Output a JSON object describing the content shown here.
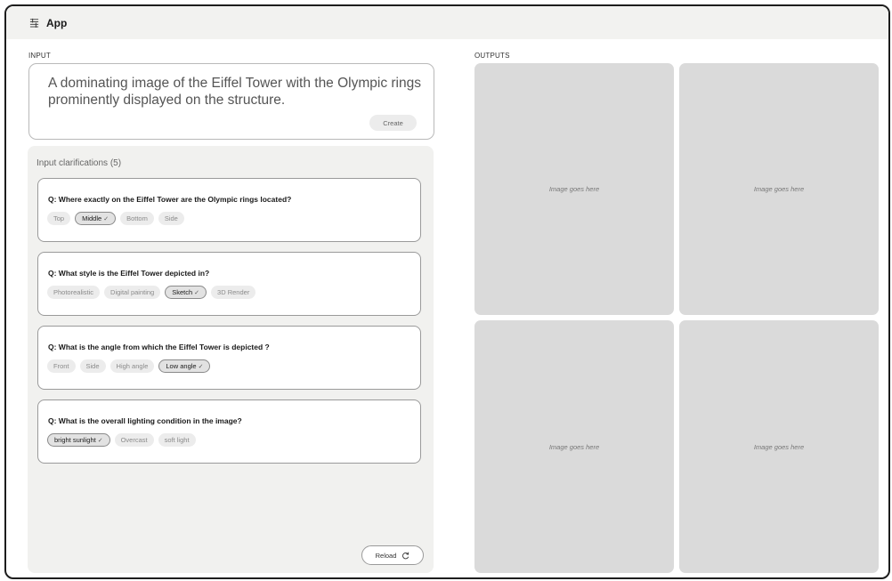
{
  "app": {
    "title": "App",
    "icon": "app-logo-icon"
  },
  "input": {
    "label": "INPUT",
    "prompt": "A dominating image of the Eiffel Tower with the Olympic rings prominently displayed on the structure.",
    "create_label": "Create"
  },
  "clarifications": {
    "title": "Input clarifications (5)",
    "questions": [
      {
        "question": "Q: Where exactly on the Eiffel Tower are the Olympic rings located?",
        "options": [
          {
            "label": "Top",
            "selected": false
          },
          {
            "label": "Middle",
            "selected": true
          },
          {
            "label": "Bottom",
            "selected": false
          },
          {
            "label": "Side",
            "selected": false
          }
        ]
      },
      {
        "question": "Q: What style is the Eiffel Tower depicted in?",
        "options": [
          {
            "label": "Photorealistic",
            "selected": false
          },
          {
            "label": "Digital painting",
            "selected": false
          },
          {
            "label": "Sketch",
            "selected": true
          },
          {
            "label": "3D Render",
            "selected": false
          }
        ]
      },
      {
        "question": "Q: What is the angle from which the Eiffel Tower is depicted ?",
        "options": [
          {
            "label": "Front",
            "selected": false
          },
          {
            "label": "Side",
            "selected": false
          },
          {
            "label": "High angle",
            "selected": false
          },
          {
            "label": "Low angle",
            "selected": true
          }
        ]
      },
      {
        "question": "Q: What is the overall lighting condition in the image?",
        "options": [
          {
            "label": "bright sunlight",
            "selected": true
          },
          {
            "label": "Overcast",
            "selected": false
          },
          {
            "label": "soft light",
            "selected": false
          }
        ]
      }
    ],
    "check_glyph": "✓",
    "reload_label": "Reload"
  },
  "outputs": {
    "label": "OUTPUTS",
    "tiles": [
      {
        "placeholder": "Image goes here"
      },
      {
        "placeholder": "Image goes here"
      },
      {
        "placeholder": "Image goes here"
      },
      {
        "placeholder": "Image goes here"
      }
    ]
  },
  "colors": {
    "titlebar_bg": "#f2f2f0",
    "panel_bg": "#f1f1ef",
    "tile_bg": "#dadada",
    "chip_bg": "#ececec"
  }
}
